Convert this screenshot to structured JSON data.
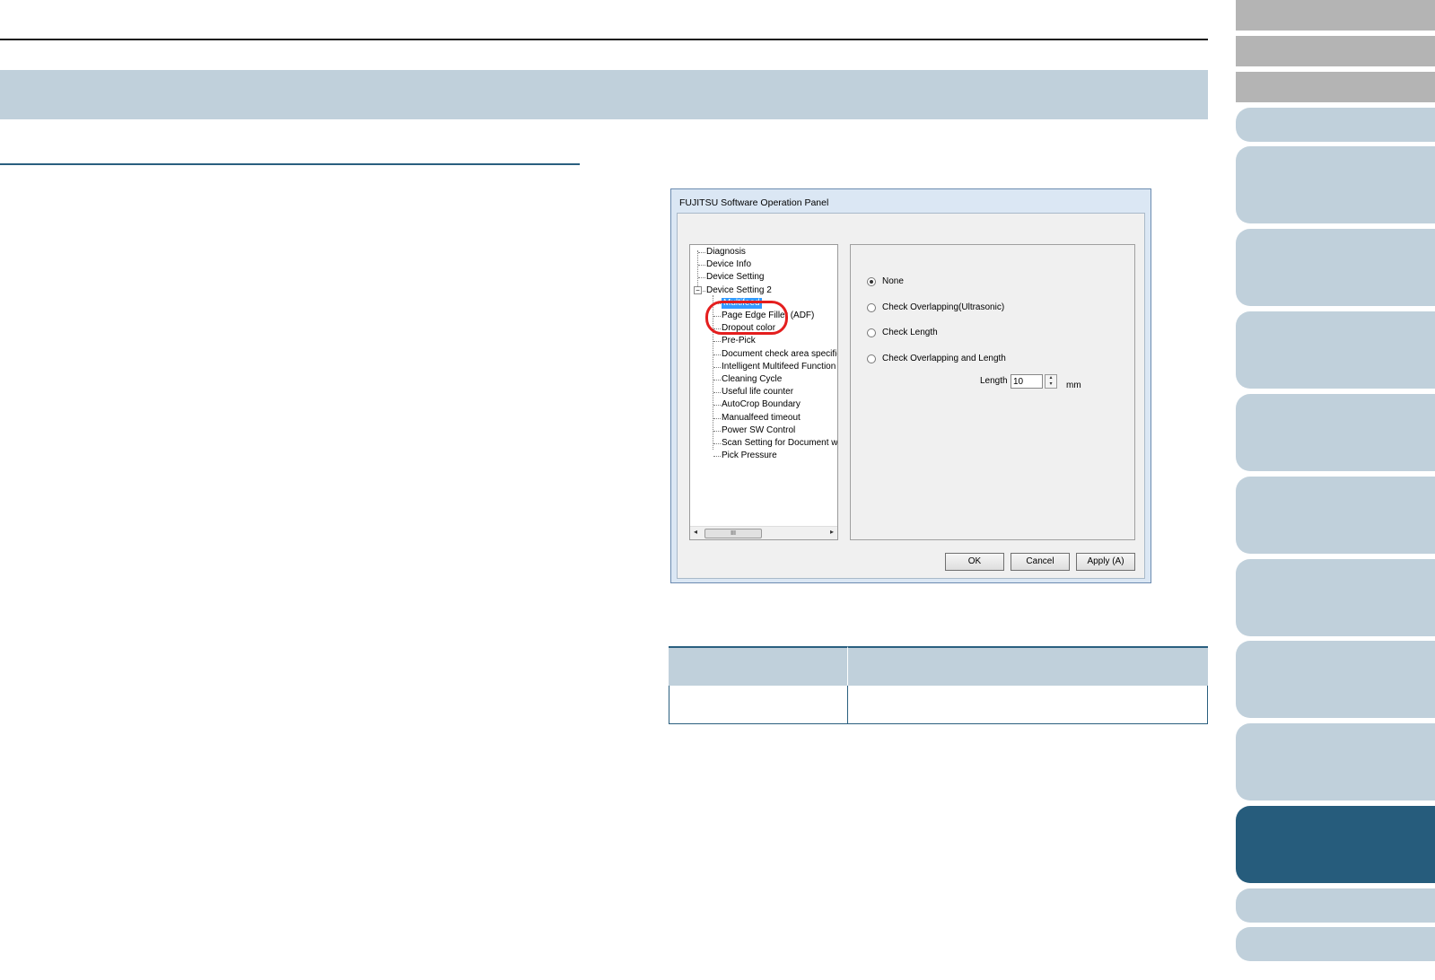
{
  "dialog": {
    "title": "FUJITSU Software Operation Panel",
    "tree": {
      "items": [
        {
          "label": "Diagnosis",
          "level": 0
        },
        {
          "label": "Device Info",
          "level": 0
        },
        {
          "label": "Device Setting",
          "level": 0
        },
        {
          "label": "Device Setting 2",
          "level": 0,
          "expander": "−"
        },
        {
          "label": "Multifeed",
          "level": 1,
          "selected": true
        },
        {
          "label": "Page Edge Filler (ADF)",
          "level": 1
        },
        {
          "label": "Dropout color",
          "level": 1
        },
        {
          "label": "Pre-Pick",
          "level": 1
        },
        {
          "label": "Document check area specific",
          "level": 1
        },
        {
          "label": "Intelligent Multifeed Function",
          "level": 1
        },
        {
          "label": "Cleaning Cycle",
          "level": 1
        },
        {
          "label": "Useful life counter",
          "level": 1
        },
        {
          "label": "AutoCrop Boundary",
          "level": 1
        },
        {
          "label": "Manualfeed timeout",
          "level": 1
        },
        {
          "label": "Power SW Control",
          "level": 1
        },
        {
          "label": "Scan Setting for Document wit",
          "level": 1
        },
        {
          "label": "Pick Pressure",
          "level": 1
        }
      ],
      "scroll_left": "◂",
      "scroll_right": "▸",
      "scroll_thumb": "III"
    },
    "options": {
      "radios": [
        {
          "label": "None",
          "checked": true
        },
        {
          "label": "Check Overlapping(Ultrasonic)",
          "checked": false
        },
        {
          "label": "Check Length",
          "checked": false
        },
        {
          "label": "Check Overlapping and Length",
          "checked": false
        }
      ],
      "length_label": "Length",
      "length_value": "10",
      "spin_up": "▴",
      "spin_down": "▾",
      "unit": "mm"
    },
    "buttons": {
      "ok": "OK",
      "cancel": "Cancel",
      "apply": "Apply (A)"
    }
  },
  "colors": {
    "band": "#c0d0db",
    "active_tab": "#265c7c",
    "highlight": "#e41e1e"
  }
}
